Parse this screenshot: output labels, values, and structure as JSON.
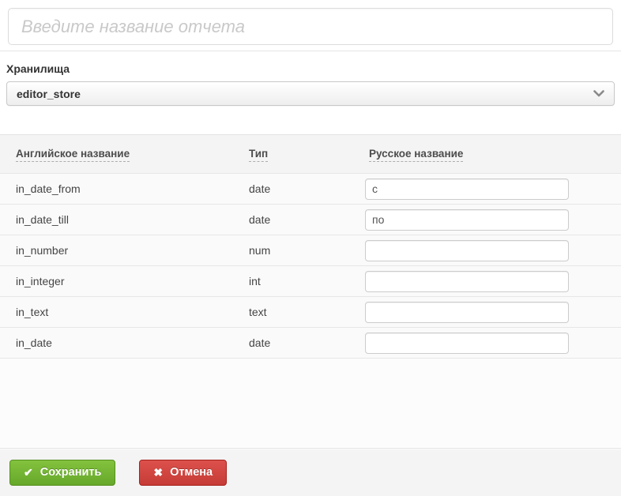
{
  "report_name_input": {
    "value": "",
    "placeholder": "Введите название отчета"
  },
  "storage": {
    "label": "Хранилища",
    "selected_value": "editor_store"
  },
  "table": {
    "headers": [
      "Английское название",
      "Тип",
      "Русское название"
    ],
    "rows": [
      {
        "name": "in_date_from",
        "type": "date",
        "russian_value": "с"
      },
      {
        "name": "in_date_till",
        "type": "date",
        "russian_value": "по"
      },
      {
        "name": "in_number",
        "type": "num",
        "russian_value": ""
      },
      {
        "name": "in_integer",
        "type": "int",
        "russian_value": ""
      },
      {
        "name": "in_text",
        "type": "text",
        "russian_value": ""
      },
      {
        "name": "in_date",
        "type": "date",
        "russian_value": ""
      }
    ]
  },
  "footer": {
    "save_label": "Сохранить",
    "cancel_label": "Отмена",
    "check_icon": "✔",
    "x_icon": "✖"
  },
  "colors": {
    "save_button_green": "#74b534",
    "save_border_green": "#569120",
    "cancel_button_red": "#d1453f",
    "cancel_border_red": "#a8221d",
    "header_band_gray": "#f4f4f4",
    "row_bg_gray": "#fafafa",
    "footer_band_gray": "#f4f4f4",
    "placeholder_gray": "#c9c9c9",
    "border_gray": "#e7e7e7"
  }
}
